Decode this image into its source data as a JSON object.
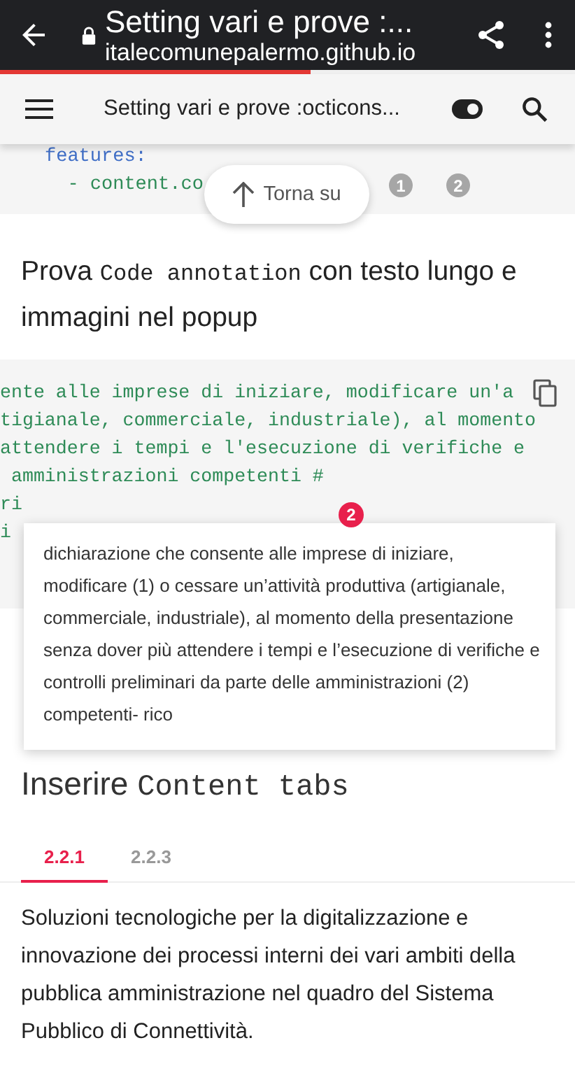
{
  "browser_bar": {
    "title": "Setting vari e prove :...",
    "url": "italecomunepalermo.github.io",
    "load_progress": {
      "level": 0.54
    }
  },
  "header": {
    "title": "Setting vari e prove :octicons...",
    "dark_mode": {
      "on": true
    }
  },
  "top_code": {
    "lines": [
      {
        "kind": "key",
        "text": "features:"
      },
      {
        "kind": "value",
        "text": "  - content.co"
      }
    ],
    "markers": [
      "1",
      "2"
    ]
  },
  "back_to_top": {
    "label": "Torna su"
  },
  "heading_1": [
    {
      "kind": "text",
      "text": "Prova "
    },
    {
      "kind": "code",
      "text": "Code annotation"
    },
    {
      "kind": "text",
      "text": " con testo lungo e immagini nel popup"
    }
  ],
  "code_block": {
    "paragraphs": [
      [
        "ente alle imprese di iniziare, modificare un'a",
        "tigianale, commerciale, industriale), al momento"
      ],
      [
        "attendere i tempi e l'esecuzione di verifiche e",
        " amministrazioni competenti #",
        "ri",
        "i"
      ]
    ]
  },
  "annotation_badge": "2",
  "tooltip": {
    "text": "dichiarazione che consente alle imprese di iniziare, modificare (1) o cessare un’attività produttiva (artigianale, commerciale, industriale), al momento della presentazione senza dover più attendere i tempi e l’esecuzione di verifiche e controlli preliminari da parte delle amministrazioni (2) competenti- rico"
  },
  "heading_2": [
    {
      "kind": "text",
      "text": "Inserire "
    },
    {
      "kind": "code",
      "text": "Content tabs"
    }
  ],
  "tabs": [
    {
      "label": "2.2.1",
      "selected": true
    },
    {
      "label": "2.2.3",
      "selected": false
    }
  ],
  "paragraph": "Soluzioni tecnologiche per la digitalizzazione e innovazione dei processi interni dei vari ambiti della pubblica amministrazione nel quadro del Sistema Pubblico di Connettività."
}
